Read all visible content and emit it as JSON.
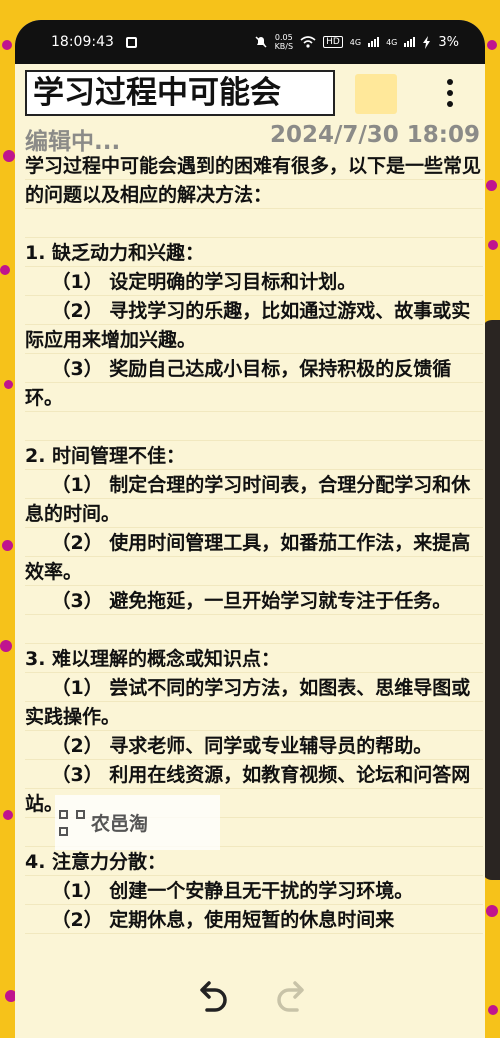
{
  "status_bar": {
    "time": "18:09:43",
    "net_speed_value": "0.05",
    "net_speed_unit": "KB/S",
    "hd_label": "HD",
    "signal_1": "4G",
    "signal_2": "4G",
    "battery": "3%"
  },
  "header": {
    "title": "学习过程中可能会"
  },
  "meta": {
    "status": "编辑中...",
    "date": "2024/7/30 18:09"
  },
  "note": {
    "body": "学习过程中可能会遇到的困难有很多，以下是一些常见的问题以及相应的解决方法：\n\n1. 缺乏动力和兴趣：\n    （1） 设定明确的学习目标和计划。\n    （2） 寻找学习的乐趣，比如通过游戏、故事或实际应用来增加兴趣。\n    （3） 奖励自己达成小目标，保持积极的反馈循环。\n\n2. 时间管理不佳：\n    （1） 制定合理的学习时间表，合理分配学习和休息的时间。\n    （2） 使用时间管理工具，如番茄工作法，来提高效率。\n    （3） 避免拖延，一旦开始学习就专注于任务。\n\n3. 难以理解的概念或知识点：\n    （1） 尝试不同的学习方法，如图表、思维导图或实践操作。\n    （2） 寻求老师、同学或专业辅导员的帮助。\n    （3） 利用在线资源，如教育视频、论坛和问答网站。\n\n4. 注意力分散：\n    （1） 创建一个安静且无干扰的学习环境。\n    （2） 定期休息，使用短暂的休息时间来"
  },
  "watermark": {
    "text": "农邑淘"
  },
  "icons": {
    "undo": "undo-icon",
    "redo": "redo-icon",
    "more": "more-vertical-icon"
  },
  "colors": {
    "background": "#f6c21a",
    "paper": "#fbf5d6",
    "accent_dots": "#c0148e"
  }
}
